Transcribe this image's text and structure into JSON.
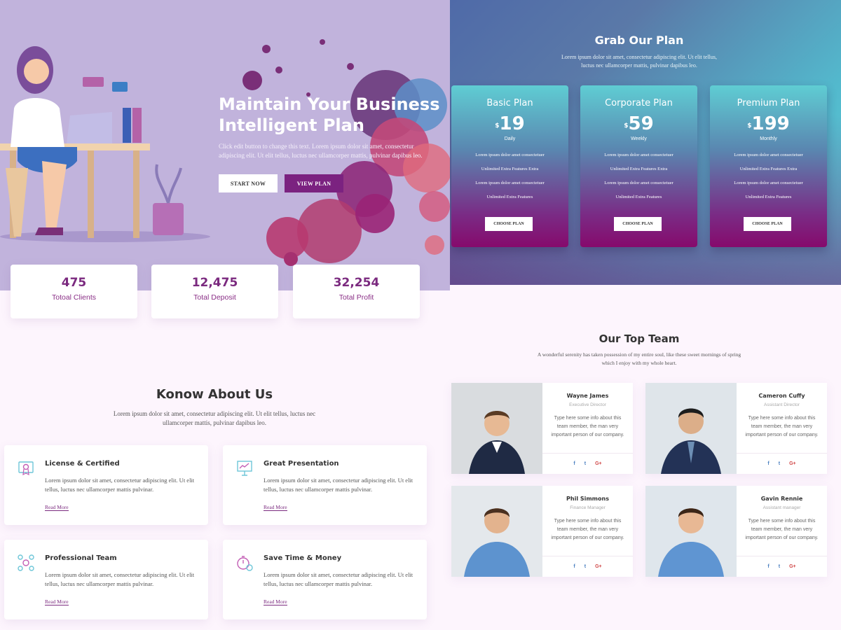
{
  "hero": {
    "title_line1": "Maintain Your Business",
    "title_line2": "Intelligent Plan",
    "description": "Click edit button to change this text. Lorem ipsum dolor sit amet, consectetur adipiscing elit. Ut elit tellus, luctus nec ullamcorper mattis, pulvinar dapibus leo.",
    "start_button": "START NOW",
    "view_button": "VIEW PLAN"
  },
  "stats": [
    {
      "value": "475",
      "label": "Totoal Clients"
    },
    {
      "value": "12,475",
      "label": "Total Deposit"
    },
    {
      "value": "32,254",
      "label": "Total Profit"
    }
  ],
  "pricing": {
    "title": "Grab Our Plan",
    "subtitle": "Lorem ipsum dolor sit amet, consectetur adipiscing elit. Ut elit tellus, luctus nec ullamcorper mattis, pulvinar dapibus leo.",
    "plans": [
      {
        "name": "Basic Plan",
        "currency": "$",
        "price": "19",
        "period": "Daily",
        "features": [
          "Lorem ipsum dolor amet consectetuer",
          "Unlimited Extra Features Extra",
          "Lorem ipsum dolor amet consectetuer",
          "Unlimited Extra Features"
        ],
        "button": "CHOOSE PLAN"
      },
      {
        "name": "Corporate Plan",
        "currency": "$",
        "price": "59",
        "period": "Weekly",
        "features": [
          "Lorem ipsum dolor amet consectetuer",
          "Unlimited Extra Features Extra",
          "Lorem ipsum dolor amet consectetuer",
          "Unlimited Extra Features"
        ],
        "button": "CHOOSE PLAN"
      },
      {
        "name": "Premium Plan",
        "currency": "$",
        "price": "199",
        "period": "Monthly",
        "features": [
          "Lorem ipsum dolor amet consectetuer",
          "Unlimited Extra Features Extra",
          "Lorem ipsum dolor amet consectetuer",
          "Unlimited Extra Features"
        ],
        "button": "CHOOSE PLAN"
      }
    ]
  },
  "about": {
    "title": "Konow About Us",
    "subtitle": "Lorem ipsum dolor sit amet, consectetur adipiscing elit. Ut elit tellus, luctus nec ullamcorper mattis, pulvinar dapibus leo.",
    "features": [
      {
        "icon": "certificate-icon",
        "title": "License & Certified",
        "text": "Lorem ipsum dolor sit amet, consectetur adipiscing elit. Ut elit tellus, luctus nec ullamcorper mattis pulvinar.",
        "link": "Read More"
      },
      {
        "icon": "presentation-icon",
        "title": "Great Presentation",
        "text": "Lorem ipsum dolor sit amet, consectetur adipiscing elit. Ut elit tellus, luctus nec ullamcorper mattis pulvinar.",
        "link": "Read More"
      },
      {
        "icon": "team-network-icon",
        "title": "Professional Team",
        "text": "Lorem ipsum dolor sit amet, consectetur adipiscing elit. Ut elit tellus, luctus nec ullamcorper mattis pulvinar.",
        "link": "Read More"
      },
      {
        "icon": "stopwatch-money-icon",
        "title": "Save Time & Money",
        "text": "Lorem ipsum dolor sit amet, consectetur adipiscing elit. Ut elit tellus, luctus nec ullamcorper mattis pulvinar.",
        "link": "Read More"
      }
    ]
  },
  "team": {
    "title": "Our Top Team",
    "subtitle": "A wonderful serenity has taken possession of my entire soul, like these sweet mornings of spring which I enjoy with my whole heart.",
    "members": [
      {
        "name": "Wayne James",
        "role": "Executive Director",
        "bio": "Type here some info about this team member, the man very important person of our company.",
        "social": [
          "f",
          "t",
          "G+"
        ]
      },
      {
        "name": "Cameron Cuffy",
        "role": "Assistant Director",
        "bio": "Type here some info about this team member, the man very important person of our company.",
        "social": [
          "f",
          "t",
          "G+"
        ]
      },
      {
        "name": "Phil Simmons",
        "role": "Finance Manager",
        "bio": "Type here some info about this team member, the man very important person of our company.",
        "social": [
          "f",
          "t",
          "G+"
        ]
      },
      {
        "name": "Gavin Rennie",
        "role": "Assistant manager",
        "bio": "Type here some info about this team member, the man very important person of our company.",
        "social": [
          "f",
          "t",
          "G+"
        ]
      }
    ]
  },
  "colors": {
    "brand_purple": "#7b2a7f",
    "hero_bg": "#c1b3dc",
    "page_bg": "#fdf5fd",
    "teal": "#5ed0d8"
  }
}
